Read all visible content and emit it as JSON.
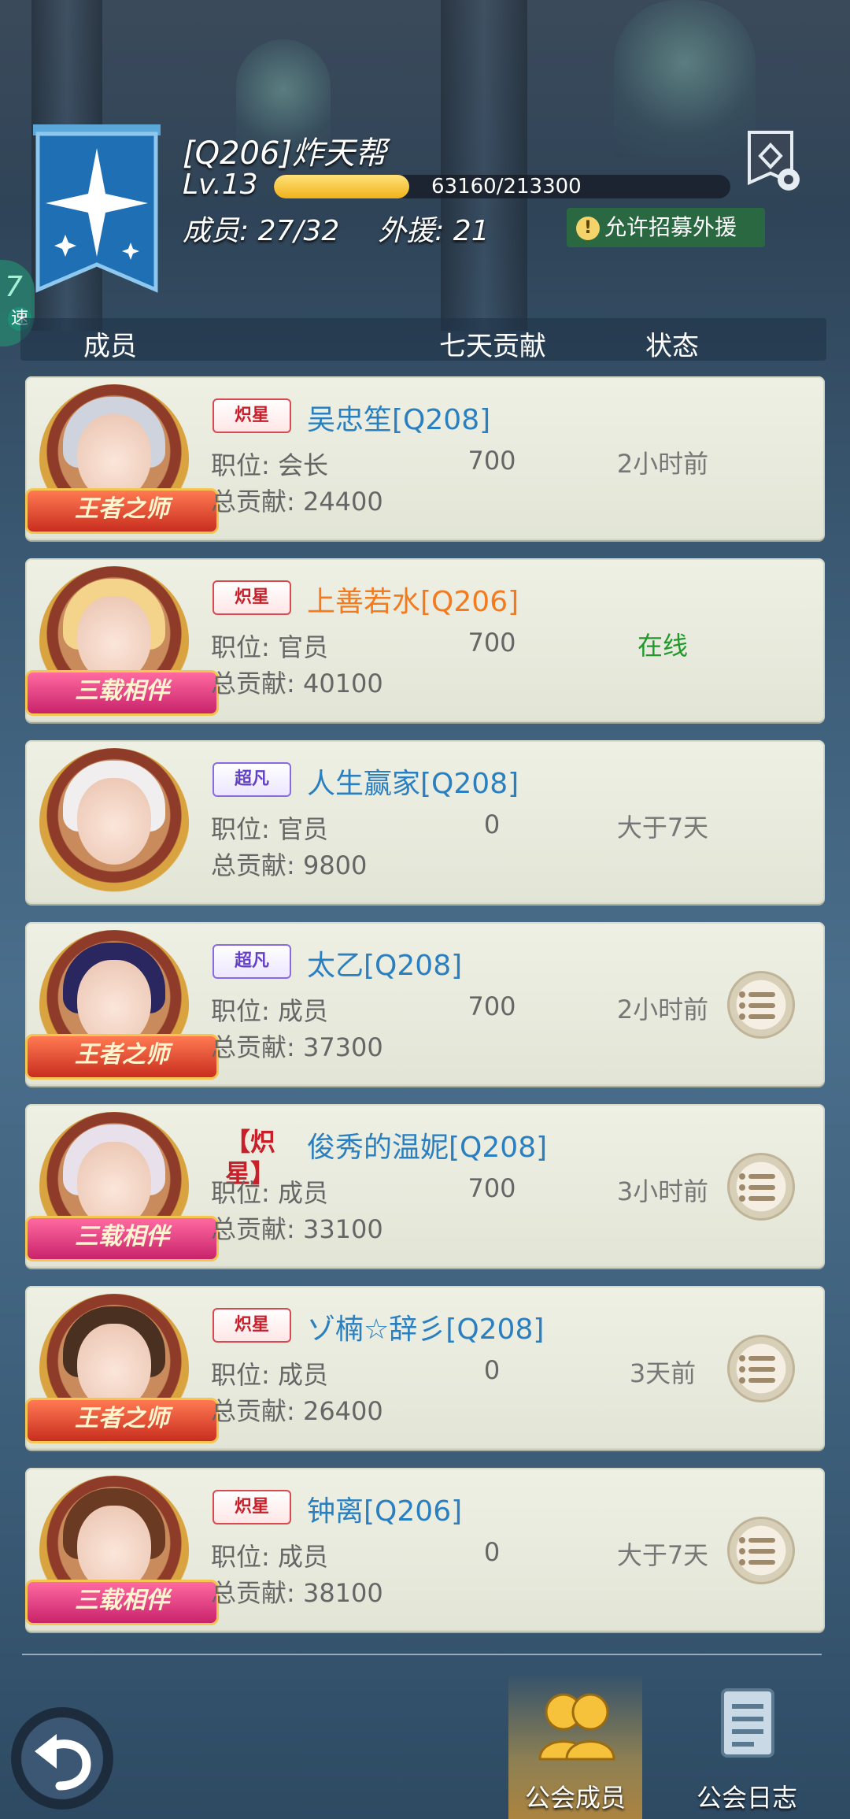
{
  "guild": {
    "name": "[Q206]炸天帮",
    "level": "Lv.13",
    "xp_text": "63160/213300",
    "xp_progress": 0.296,
    "members_label": "成员: 27/32",
    "aid_label": "外援: 21",
    "recruit_label": "允许招募外援",
    "speed_number": "7",
    "speed_label": "速"
  },
  "columns": {
    "member": "成员",
    "weekly": "七天贡献",
    "status": "状态"
  },
  "members": [
    {
      "badge": "炽星",
      "name": "吴忠笙[Q208]",
      "role": "职位: 会长",
      "weekly": "700",
      "status": "2小时前",
      "total": "总贡献: 24400",
      "ribbon": "王者之师",
      "menu": false
    },
    {
      "badge": "炽星",
      "name": "上善若水[Q206]",
      "role": "职位: 官员",
      "weekly": "700",
      "status": "在线",
      "total": "总贡献: 40100",
      "ribbon": "三载相伴",
      "menu": false
    },
    {
      "badge": "超凡",
      "name": "人生赢家[Q208]",
      "role": "职位: 官员",
      "weekly": "0",
      "status": "大于7天",
      "total": "总贡献: 9800",
      "ribbon": "",
      "menu": false
    },
    {
      "badge": "超凡",
      "name": "太乙[Q208]",
      "role": "职位: 成员",
      "weekly": "700",
      "status": "2小时前",
      "total": "总贡献: 37300",
      "ribbon": "王者之师",
      "menu": true
    },
    {
      "badge": "【炽星】",
      "name": "俊秀的温妮[Q208]",
      "role": "职位: 成员",
      "weekly": "700",
      "status": "3小时前",
      "total": "总贡献: 33100",
      "ribbon": "三载相伴",
      "menu": true
    },
    {
      "badge": "炽星",
      "name": "ゾ楠☆辞彡[Q208]",
      "role": "职位: 成员",
      "weekly": "0",
      "status": "3天前",
      "total": "总贡献: 26400",
      "ribbon": "王者之师",
      "menu": true
    },
    {
      "badge": "炽星",
      "name": "钟离[Q206]",
      "role": "职位: 成员",
      "weekly": "0",
      "status": "大于7天",
      "total": "总贡献: 38100",
      "ribbon": "三载相伴",
      "menu": true
    }
  ],
  "tabs": {
    "members": "公会成员",
    "log": "公会日志"
  },
  "icons": {
    "banner": "star-banner-icon",
    "settings": "banner-settings-icon",
    "back": "back-arrow-icon",
    "members_tab": "members-icon",
    "log_tab": "log-icon",
    "row_menu": "list-menu-icon"
  },
  "colors": {
    "name_blue": "#2a7fc1",
    "name_orange": "#f47a1f",
    "online_green": "#1f9a2a",
    "xp_gold": "#f0b21a"
  }
}
